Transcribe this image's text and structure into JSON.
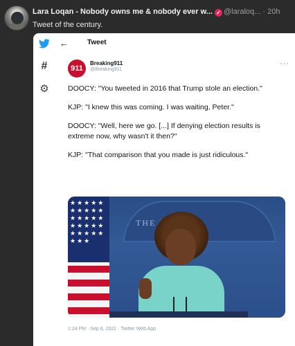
{
  "post": {
    "display_name": "Lara Loqan - Nobody owns me & nobody ever w...",
    "handle": "@laraloq...",
    "separator": "·",
    "age": "20h",
    "text": "Tweet of the century."
  },
  "embedded_tweet": {
    "topbar_title": "Tweet",
    "author_name": "Breaking911",
    "author_handle": "@Breaking911",
    "avatar_text": "911",
    "paragraphs": [
      "DOOCY: \"You tweeted in 2016 that Trump stole an election.\"",
      "KJP: \"I knew this was coming. I was waiting, Peter.\"",
      "DOOCY: \"Well, here we go. [...] If denying election results is extreme now, why wasn't it then?\"",
      "KJP: \"That comparison that you made is just ridiculous.\""
    ],
    "photo_sign": "THE    HOUSE",
    "meta": "1:24 PM · Sep 6, 2022 · Twitter Web App"
  },
  "icons": {
    "avatar": "user-avatar",
    "verified": "verified-badge-icon",
    "twitter": "twitter-bird-icon",
    "hashtag": "hashtag-icon",
    "settings": "gear-icon",
    "back": "back-arrow-icon",
    "more": "more-dots-icon"
  },
  "colors": {
    "background": "#2b2b2b",
    "card": "#ffffff",
    "twitter_blue": "#1d9bf0",
    "verified": "#e0245e",
    "breaking911_red": "#c8102e"
  }
}
